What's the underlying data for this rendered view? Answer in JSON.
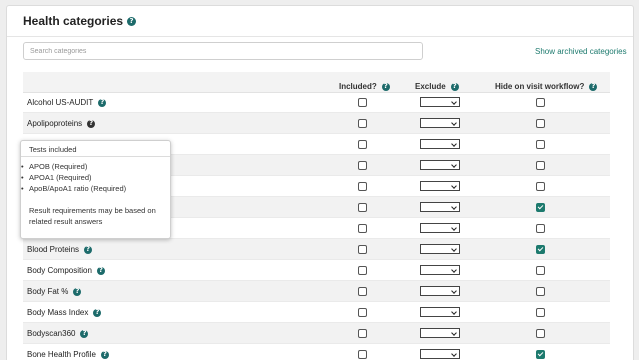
{
  "card": {
    "title": "Health categories",
    "help_icon": "question-circle-icon"
  },
  "search": {
    "placeholder": "Search categories",
    "value": ""
  },
  "archived_link": "Show archived categories",
  "table": {
    "columns": {
      "included": "Included?",
      "exclude": "Exclude",
      "hide": "Hide on visit workflow?"
    },
    "rows": [
      {
        "name": "Alcohol US-AUDIT",
        "included": false,
        "exclude": "",
        "hide": false
      },
      {
        "name": "Apolipoproteins",
        "included": false,
        "exclude": "",
        "hide": false
      },
      {
        "name": "",
        "included": false,
        "exclude": "",
        "hide": false
      },
      {
        "name": "",
        "included": false,
        "exclude": "",
        "hide": false
      },
      {
        "name": "",
        "included": false,
        "exclude": "",
        "hide": false
      },
      {
        "name": "",
        "included": false,
        "exclude": "",
        "hide": true
      },
      {
        "name": "",
        "included": false,
        "exclude": "",
        "hide": false
      },
      {
        "name": "Blood Proteins",
        "included": false,
        "exclude": "",
        "hide": true
      },
      {
        "name": "Body Composition",
        "included": false,
        "exclude": "",
        "hide": false
      },
      {
        "name": "Body Fat %",
        "included": false,
        "exclude": "",
        "hide": false
      },
      {
        "name": "Body Mass Index",
        "included": false,
        "exclude": "",
        "hide": false
      },
      {
        "name": "Bodyscan360",
        "included": false,
        "exclude": "",
        "hide": false
      },
      {
        "name": "Bone Health Profile",
        "included": false,
        "exclude": "",
        "hide": true
      }
    ]
  },
  "tooltip": {
    "heading": "Tests included",
    "items": [
      "APOB (Required)",
      "APOA1 (Required)",
      "ApoB/ApoA1 ratio (Required)"
    ],
    "note": "Result requirements may be based on related result answers"
  },
  "colors": {
    "accent": "#1d7a6e",
    "help_icon": "#1d6b6b",
    "row_alt": "#f2f2f2",
    "page_bg": "#eeeeee"
  }
}
